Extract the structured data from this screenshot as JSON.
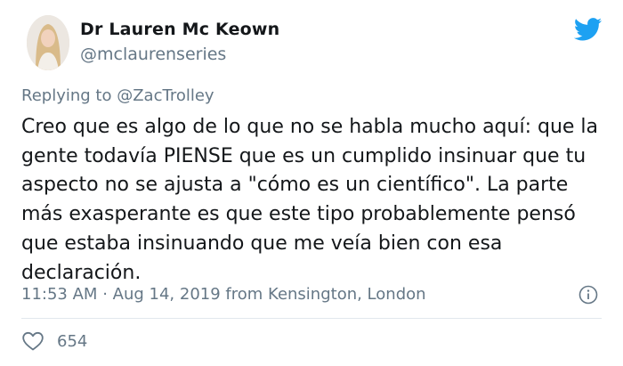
{
  "author": {
    "name": "Dr Lauren Mc Keown",
    "handle": "@mclaurenseries",
    "avatar_icon": "profile-photo"
  },
  "reply": {
    "prefix": "Replying to",
    "mention": "@ZacTrolley"
  },
  "tweet": {
    "text": "Creo que es algo de lo que no se habla mucho aquí: que la gente todavía PIENSE que es un cumplido insinuar que tu aspecto no se ajusta a \"cómo es un científico\". La parte más exasperante es que este tipo probablemente pensó que estaba insinuando que me veía bien con esa declaración.",
    "time": "11:53 AM",
    "separator": "·",
    "date": "Aug 14, 2019",
    "location": "from Kensington, London"
  },
  "engagement": {
    "likes": "654"
  },
  "colors": {
    "brand": "#1da1f2",
    "text": "#14171a",
    "muted": "#657786",
    "divider": "#e1e8ed"
  },
  "icons": {
    "brand": "twitter-bird-icon",
    "info": "info-icon",
    "like": "heart-icon"
  }
}
